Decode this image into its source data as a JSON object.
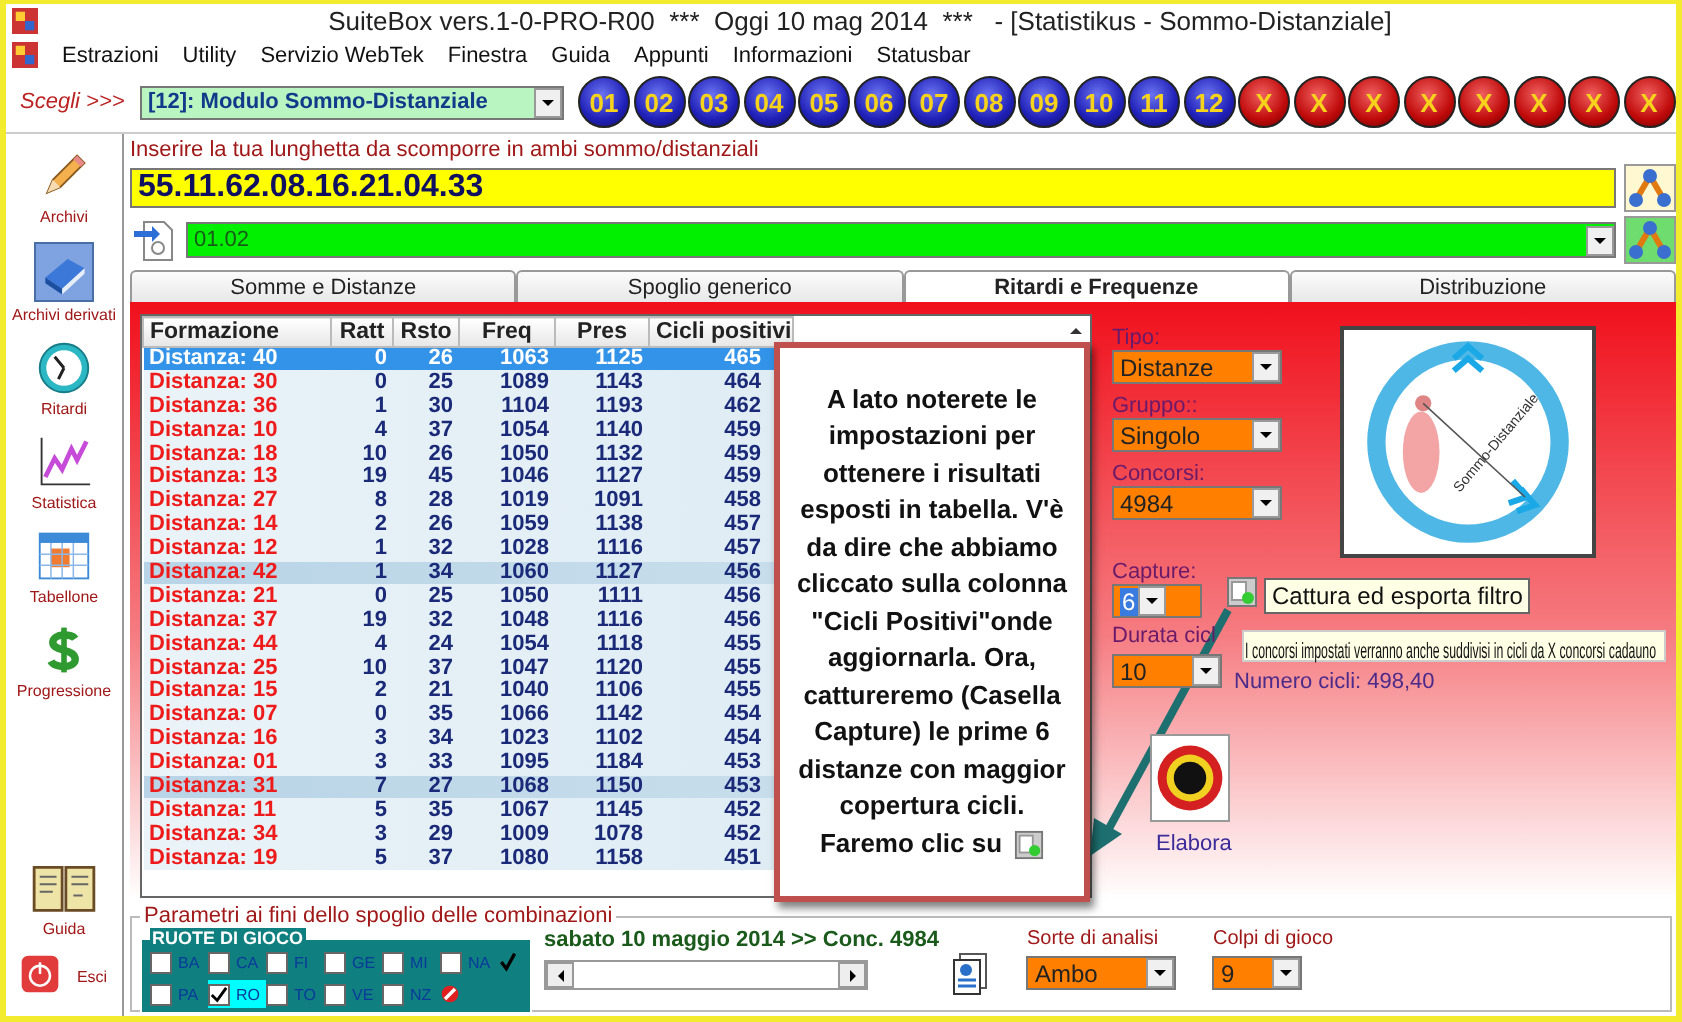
{
  "window": {
    "title": "SuiteBox vers.1-0-PRO-R00  ***  Oggi 10 mag 2014  ***   - [Statistikus - Sommo-Distanziale]"
  },
  "menu": [
    "Estrazioni",
    "Utility",
    "Servizio WebTek",
    "Finestra",
    "Guida",
    "Appunti",
    "Informazioni",
    "Statusbar"
  ],
  "toolbar": {
    "prompt": "Scegli >>>",
    "module": "[12]: Modulo Sommo-Distanziale",
    "balls": [
      {
        "label": "01",
        "kind": "number"
      },
      {
        "label": "02",
        "kind": "number"
      },
      {
        "label": "03",
        "kind": "number"
      },
      {
        "label": "04",
        "kind": "number"
      },
      {
        "label": "05",
        "kind": "number"
      },
      {
        "label": "06",
        "kind": "number"
      },
      {
        "label": "07",
        "kind": "number"
      },
      {
        "label": "08",
        "kind": "number"
      },
      {
        "label": "09",
        "kind": "number"
      },
      {
        "label": "10",
        "kind": "number"
      },
      {
        "label": "11",
        "kind": "number"
      },
      {
        "label": "12",
        "kind": "number"
      },
      {
        "label": "X",
        "kind": "blocked"
      },
      {
        "label": "X",
        "kind": "blocked"
      },
      {
        "label": "X",
        "kind": "blocked"
      },
      {
        "label": "X",
        "kind": "blocked"
      },
      {
        "label": "X",
        "kind": "blocked"
      },
      {
        "label": "X",
        "kind": "blocked"
      },
      {
        "label": "X",
        "kind": "blocked"
      },
      {
        "label": "X",
        "kind": "blocked"
      }
    ]
  },
  "sidebar": {
    "items": [
      {
        "label": "Archivi",
        "kind": "pencil",
        "selected": false
      },
      {
        "label": "Archivi derivati",
        "kind": "book",
        "selected": true
      },
      {
        "label": "Ritardi",
        "kind": "clock",
        "selected": false
      },
      {
        "label": "Statistica",
        "kind": "chart",
        "selected": false
      },
      {
        "label": "Tabellone",
        "kind": "grid",
        "selected": false
      },
      {
        "label": "Progressione",
        "kind": "dollar",
        "selected": false
      }
    ],
    "bottom_items": [
      {
        "label": "Guida",
        "kind": "guide"
      },
      {
        "label": "Esci",
        "kind": "exit"
      }
    ]
  },
  "input": {
    "label": "Inserire la tua lunghetta da scomporre in ambi sommo/distanziali",
    "value": "55.11.62.08.16.21.04.33"
  },
  "selector": {
    "value": "01.02"
  },
  "tabs": [
    {
      "label": "Somme e Distanze",
      "selected": false
    },
    {
      "label": "Spoglio generico",
      "selected": false
    },
    {
      "label": "Ritardi e Frequenze",
      "selected": true
    },
    {
      "label": "Distribuzione",
      "selected": false
    }
  ],
  "table": {
    "columns": [
      "Formazione",
      "Ratt",
      "Rsto",
      "Freq",
      "Pres",
      "Cicli positivi"
    ],
    "rows": [
      {
        "cells": [
          "Distanza: 40",
          "0",
          "26",
          "1063",
          "1125",
          "465"
        ],
        "selected": true
      },
      {
        "cells": [
          "Distanza: 30",
          "0",
          "25",
          "1089",
          "1143",
          "464"
        ],
        "selected": false
      },
      {
        "cells": [
          "Distanza: 36",
          "1",
          "30",
          "1104",
          "1193",
          "462"
        ],
        "selected": false
      },
      {
        "cells": [
          "Distanza: 10",
          "4",
          "37",
          "1054",
          "1140",
          "459"
        ],
        "selected": false
      },
      {
        "cells": [
          "Distanza: 18",
          "10",
          "26",
          "1050",
          "1132",
          "459"
        ],
        "selected": false
      },
      {
        "cells": [
          "Distanza: 13",
          "19",
          "45",
          "1046",
          "1127",
          "459"
        ],
        "selected": false
      },
      {
        "cells": [
          "Distanza: 27",
          "8",
          "28",
          "1019",
          "1091",
          "458"
        ],
        "selected": false
      },
      {
        "cells": [
          "Distanza: 14",
          "2",
          "26",
          "1059",
          "1138",
          "457"
        ],
        "selected": false
      },
      {
        "cells": [
          "Distanza: 12",
          "1",
          "32",
          "1028",
          "1116",
          "457"
        ],
        "selected": false
      },
      {
        "cells": [
          "Distanza: 42",
          "1",
          "34",
          "1060",
          "1127",
          "456"
        ],
        "selected": false
      },
      {
        "cells": [
          "Distanza: 21",
          "0",
          "25",
          "1050",
          "1111",
          "456"
        ],
        "selected": false
      },
      {
        "cells": [
          "Distanza: 37",
          "19",
          "32",
          "1048",
          "1116",
          "456"
        ],
        "selected": false
      },
      {
        "cells": [
          "Distanza: 44",
          "4",
          "24",
          "1054",
          "1118",
          "455"
        ],
        "selected": false
      },
      {
        "cells": [
          "Distanza: 25",
          "10",
          "37",
          "1047",
          "1120",
          "455"
        ],
        "selected": false
      },
      {
        "cells": [
          "Distanza: 15",
          "2",
          "21",
          "1040",
          "1106",
          "455"
        ],
        "selected": false
      },
      {
        "cells": [
          "Distanza: 07",
          "0",
          "35",
          "1066",
          "1142",
          "454"
        ],
        "selected": false
      },
      {
        "cells": [
          "Distanza: 16",
          "3",
          "34",
          "1023",
          "1102",
          "454"
        ],
        "selected": false
      },
      {
        "cells": [
          "Distanza: 01",
          "3",
          "33",
          "1095",
          "1184",
          "453"
        ],
        "selected": false
      },
      {
        "cells": [
          "Distanza: 31",
          "7",
          "27",
          "1068",
          "1150",
          "453"
        ],
        "selected": false
      },
      {
        "cells": [
          "Distanza: 11",
          "5",
          "35",
          "1067",
          "1145",
          "452"
        ],
        "selected": false
      },
      {
        "cells": [
          "Distanza: 34",
          "3",
          "29",
          "1009",
          "1078",
          "452"
        ],
        "selected": false
      },
      {
        "cells": [
          "Distanza: 19",
          "5",
          "37",
          "1080",
          "1158",
          "451"
        ],
        "selected": false
      }
    ]
  },
  "callout": {
    "text": "A lato noterete le impostazioni per ottenere i risultati esposti in tabella. V'è da dire che abbiamo cliccato sulla colonna \"Cicli Positivi\"onde aggiornarla. Ora, cattureremo (Casella Capture) le prime 6 distanze con maggior copertura cicli. Faremo clic su"
  },
  "settings": {
    "tipo": {
      "label": "Tipo:",
      "value": "Distanze"
    },
    "gruppo": {
      "label": "Gruppo::",
      "value": "Singolo"
    },
    "concorsi": {
      "label": "Concorsi:",
      "value": "4984"
    },
    "capture": {
      "label": "Capture:",
      "value": "6"
    },
    "durata": {
      "label": "Durata cicl",
      "value": "10"
    },
    "numero_cicli": "Numero cicli: 498,40"
  },
  "emblem": {
    "caption": "Sommo-Distanziale"
  },
  "tooltips": [
    "Cattura ed esporta filtro",
    "I concorsi impostati verranno anche suddivisi in cicli da X concorsi cadauno"
  ],
  "action": {
    "label": "Elabora"
  },
  "params": {
    "title": "Parametri ai fini dello spoglio delle combinazioni",
    "ruote_title": "RUOTE DI GIOCO",
    "ruote": [
      {
        "label": "BA",
        "checked": false
      },
      {
        "label": "CA",
        "checked": false
      },
      {
        "label": "FI",
        "checked": false
      },
      {
        "label": "GE",
        "checked": false
      },
      {
        "label": "MI",
        "checked": false
      },
      {
        "label": "NA",
        "checked": false
      },
      {
        "label": "PA",
        "checked": false
      },
      {
        "label": "RO",
        "checked": true
      },
      {
        "label": "TO",
        "checked": false
      },
      {
        "label": "VE",
        "checked": false
      },
      {
        "label": "NZ",
        "checked": false
      }
    ],
    "date": "sabato 10 maggio 2014 >> Conc. 4984",
    "sorte": {
      "label": "Sorte di analisi",
      "value": "Ambo"
    },
    "colpi": {
      "label": "Colpi di gioco",
      "value": "9"
    }
  }
}
